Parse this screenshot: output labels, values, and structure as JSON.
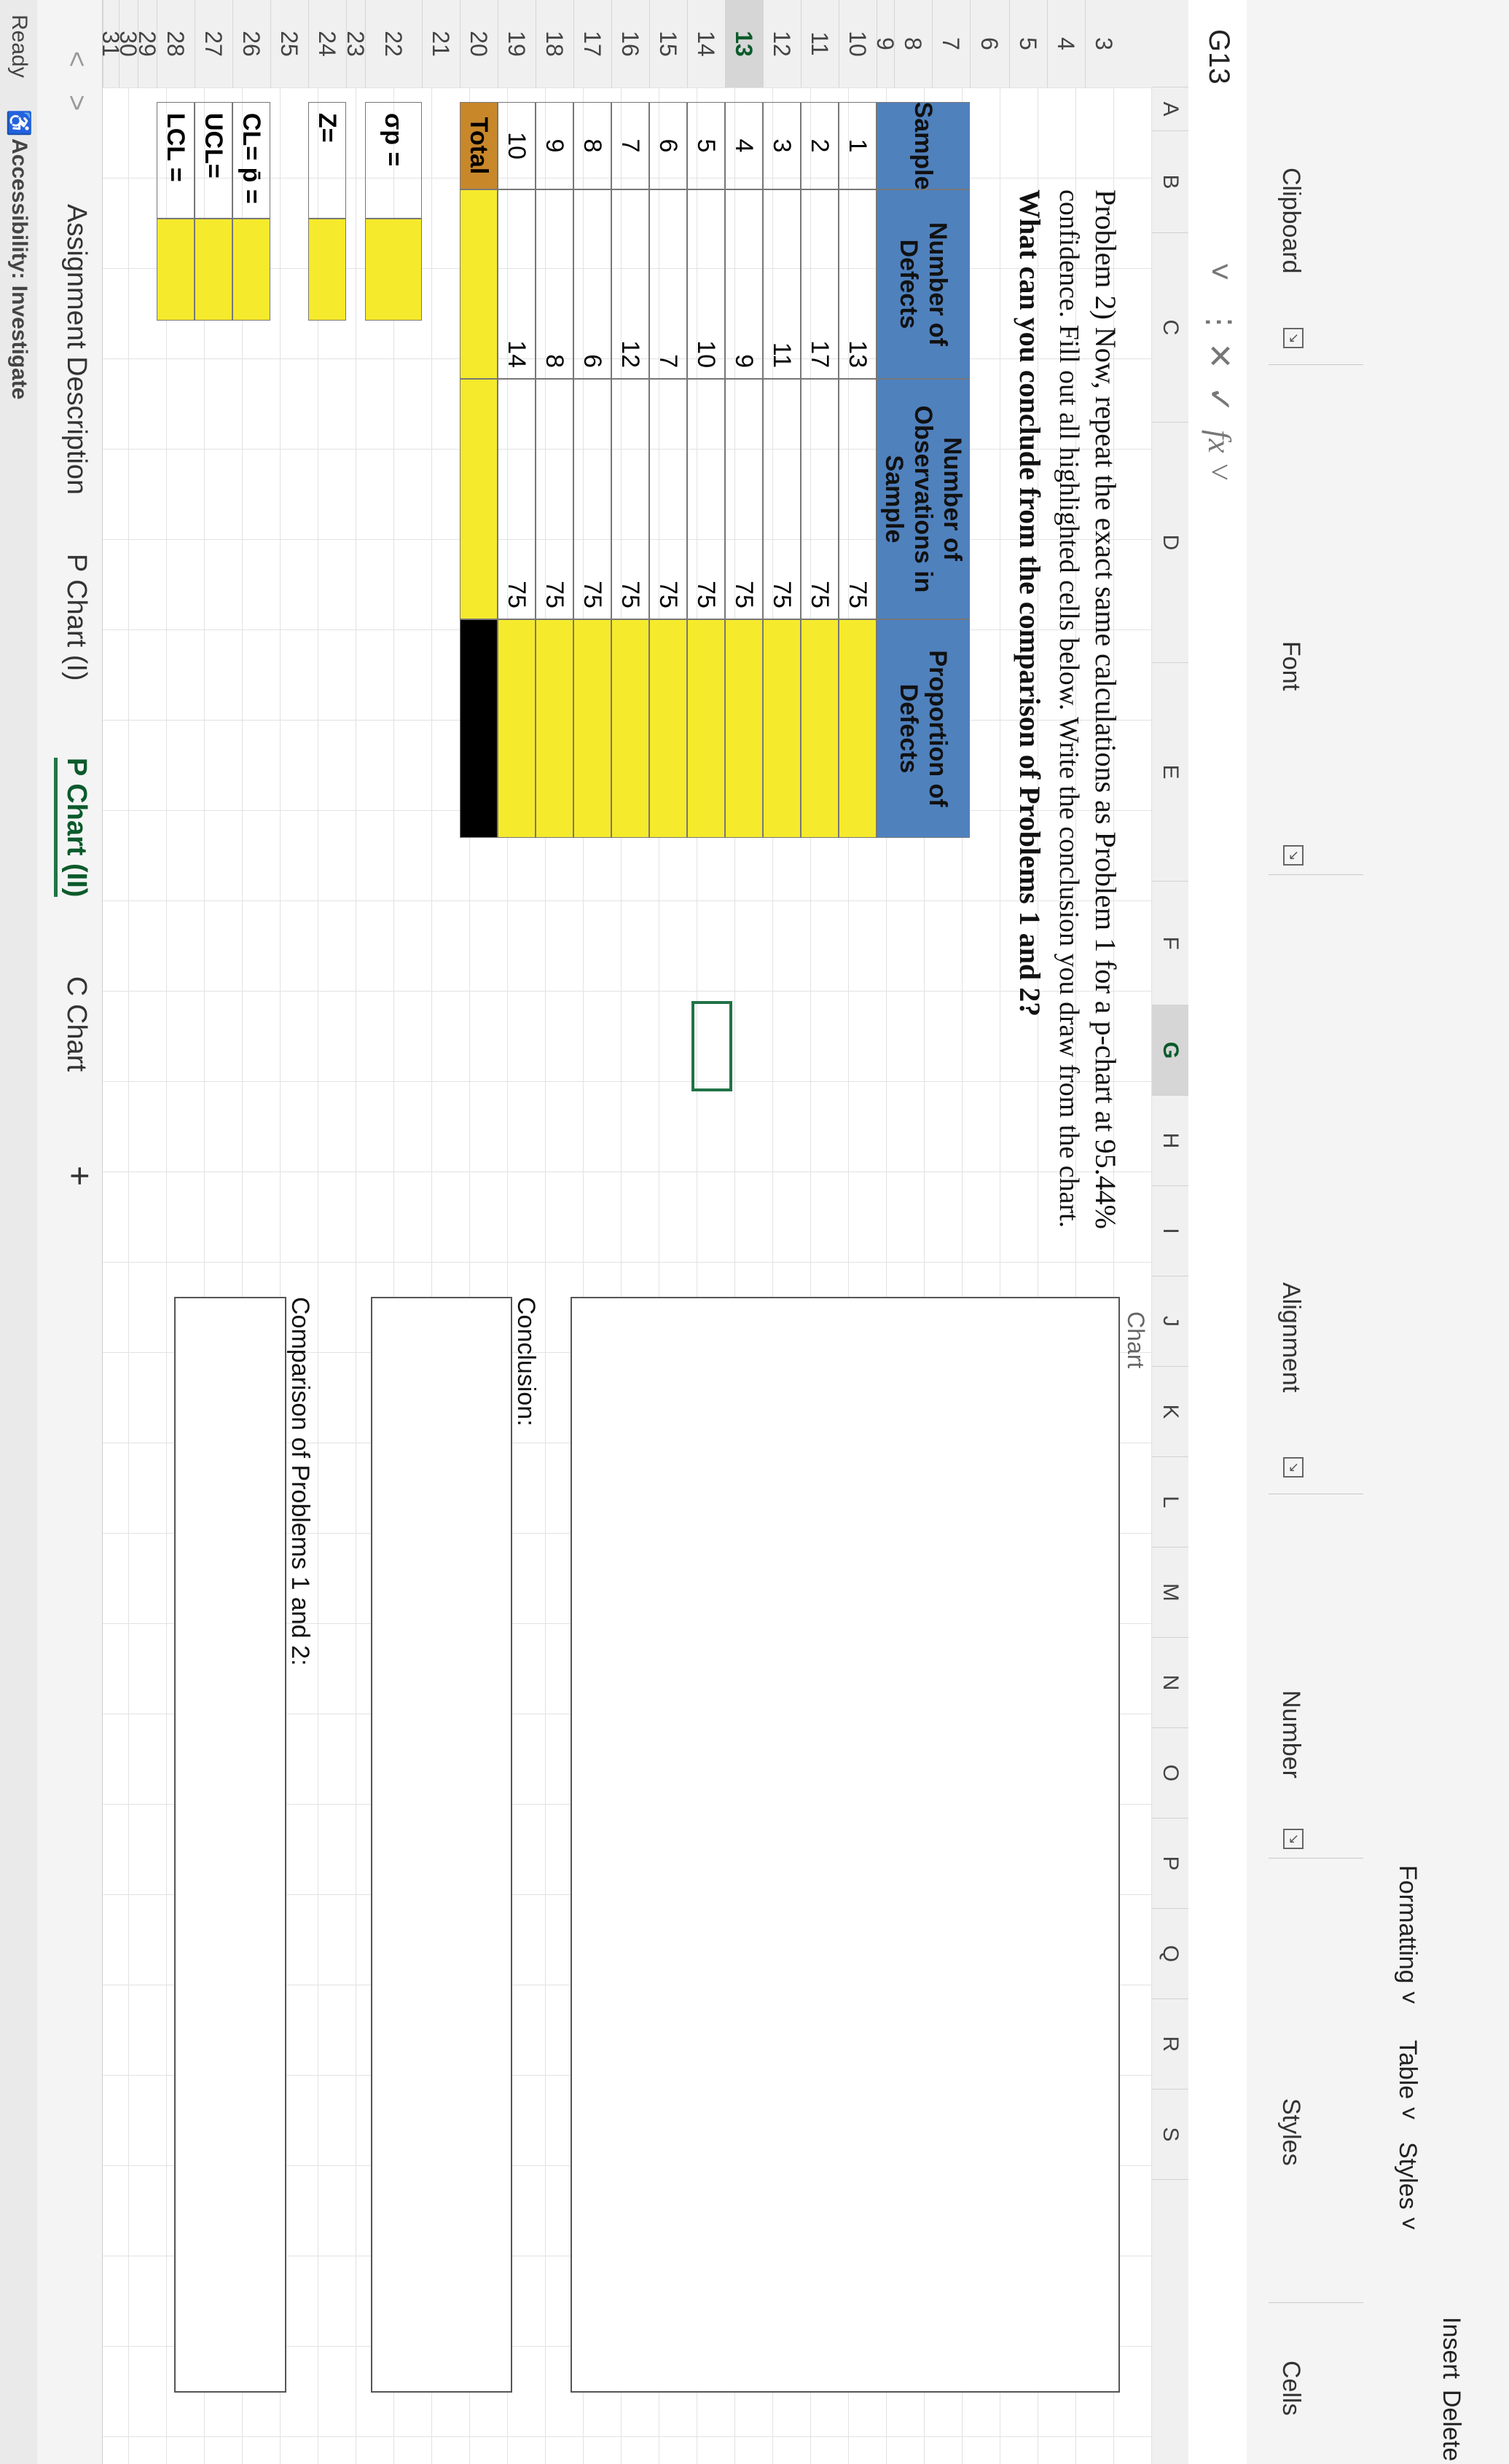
{
  "ribbon": {
    "groups": [
      "Clipboard",
      "Font",
      "Alignment",
      "Number",
      "Styles",
      "Cells"
    ],
    "buttons": {
      "formatting": "Formatting ˅",
      "table": "Table ˅",
      "styles": "Styles ˅",
      "insert": "Insert",
      "delete": "Delete"
    }
  },
  "formula_bar": {
    "name_box": "G13",
    "cancel_icon": "✕",
    "enter_icon": "✓",
    "fx_icon": "fx ˅",
    "value": ""
  },
  "columns": [
    "A",
    "B",
    "C",
    "D",
    "E",
    "F",
    "G",
    "H",
    "I",
    "J",
    "K",
    "L",
    "M",
    "N",
    "O",
    "P",
    "Q",
    "R",
    "S"
  ],
  "rows": [
    "3",
    "4",
    "5",
    "6",
    "7",
    "8",
    "9",
    "10",
    "11",
    "12",
    "13",
    "14",
    "15",
    "16",
    "17",
    "18",
    "19",
    "20",
    "21",
    "22",
    "23",
    "24",
    "25",
    "26",
    "27",
    "28",
    "29",
    "30",
    "31",
    "32"
  ],
  "selected": {
    "column": "G",
    "row": "13"
  },
  "problem": {
    "line1": "Problem 2) Now, repeat the exact same calculations as Problem 1 for a p-chart at 95.44%",
    "line2": "confidence. Fill out all highlighted cells below. Write the conclusion you draw from the chart.",
    "line3": "What can you conclude from the comparison of Problems 1 and 2?"
  },
  "table": {
    "headers": [
      "Sample",
      "Number of Defects",
      "Number of Observations in Sample",
      "Proportion of Defects"
    ],
    "rows": [
      {
        "sample": "1",
        "defects": "13",
        "observations": "75"
      },
      {
        "sample": "2",
        "defects": "17",
        "observations": "75"
      },
      {
        "sample": "3",
        "defects": "11",
        "observations": "75"
      },
      {
        "sample": "4",
        "defects": "9",
        "observations": "75"
      },
      {
        "sample": "5",
        "defects": "10",
        "observations": "75"
      },
      {
        "sample": "6",
        "defects": "7",
        "observations": "75"
      },
      {
        "sample": "7",
        "defects": "12",
        "observations": "75"
      },
      {
        "sample": "8",
        "defects": "6",
        "observations": "75"
      },
      {
        "sample": "9",
        "defects": "8",
        "observations": "75"
      },
      {
        "sample": "10",
        "defects": "14",
        "observations": "75"
      }
    ],
    "total_label": "Total"
  },
  "stats": {
    "sigma_p": "σp =",
    "z": "Z=",
    "cl": "CL= p̄ =",
    "ucl": "UCL=",
    "lcl": "LCL ="
  },
  "side_labels": {
    "chart_partial": "Chart",
    "conclusion": "Conclusion:",
    "comparison": "Comparison of Problems 1 and 2:"
  },
  "sheet_tabs": [
    "Assignment Description",
    "P Chart (I)",
    "P Chart (II)",
    "C Chart"
  ],
  "active_tab": "P Chart (II)",
  "tab_nav": {
    "prev": "<",
    "next": ">",
    "add": "+"
  },
  "status_bar": {
    "ready": "Ready",
    "accessibility": "Accessibility: Investigate"
  },
  "colors": {
    "header_blue": "#4f81bd",
    "highlight_yellow": "#f6ea2c",
    "total_orange": "#c8882a",
    "excel_green": "#217346"
  }
}
